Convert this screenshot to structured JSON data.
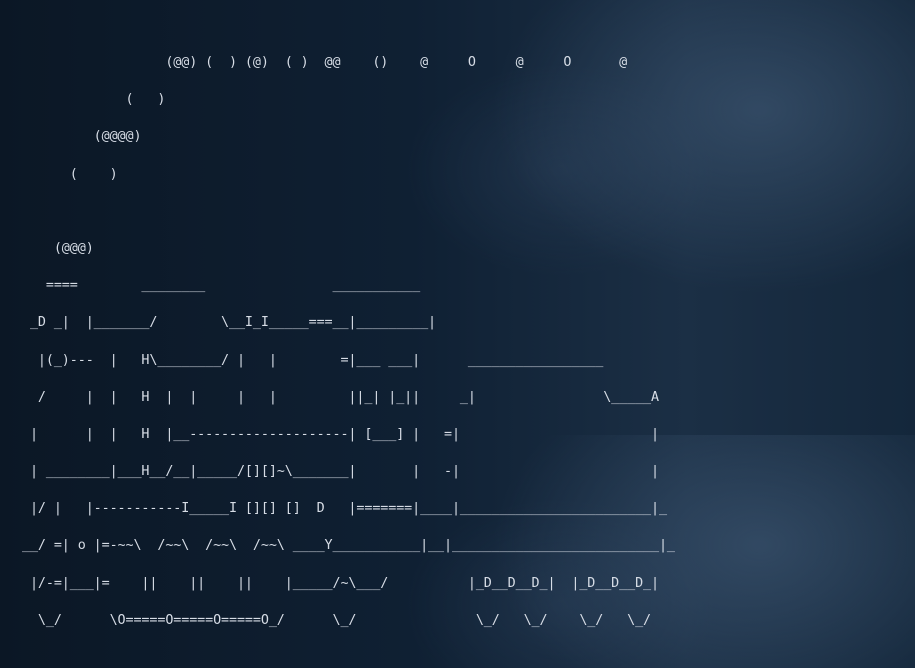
{
  "terminal": {
    "lines": [
      "                  (@@) (  ) (@)  ( )  @@    ()    @     O     @     O      @",
      "             (   )",
      "         (@@@@)",
      "      (    )",
      "",
      "    (@@@)",
      "   ====        ________                ___________",
      " _D _|  |_______/        \\__I_I_____===__|_________|",
      "  |(_)---  |   H\\________/ |   |        =|___ ___|      _________________",
      "  /     |  |   H  |  |     |   |         ||_| |_||     _|                \\_____A",
      " |      |  |   H  |__--------------------| [___] |   =|                        |",
      " | ________|___H__/__|_____/[][]~\\_______|       |   -|                        |",
      " |/ |   |-----------I_____I [][] []  D   |=======|____|________________________|_",
      "__/ =| o |=-~~\\  /~~\\  /~~\\  /~~\\ ____Y___________|__|__________________________|_",
      " |/-=|___|=    ||    ||    ||    |_____/~\\___/          |_D__D__D_|  |_D__D__D_|",
      "  \\_/      \\O=====O=====O=====O_/      \\_/               \\_/   \\_/    \\_/   \\_/"
    ]
  },
  "colors": {
    "text": "#d7dde6",
    "background_left": "#0b1725",
    "background_right": "#1b2f45"
  }
}
